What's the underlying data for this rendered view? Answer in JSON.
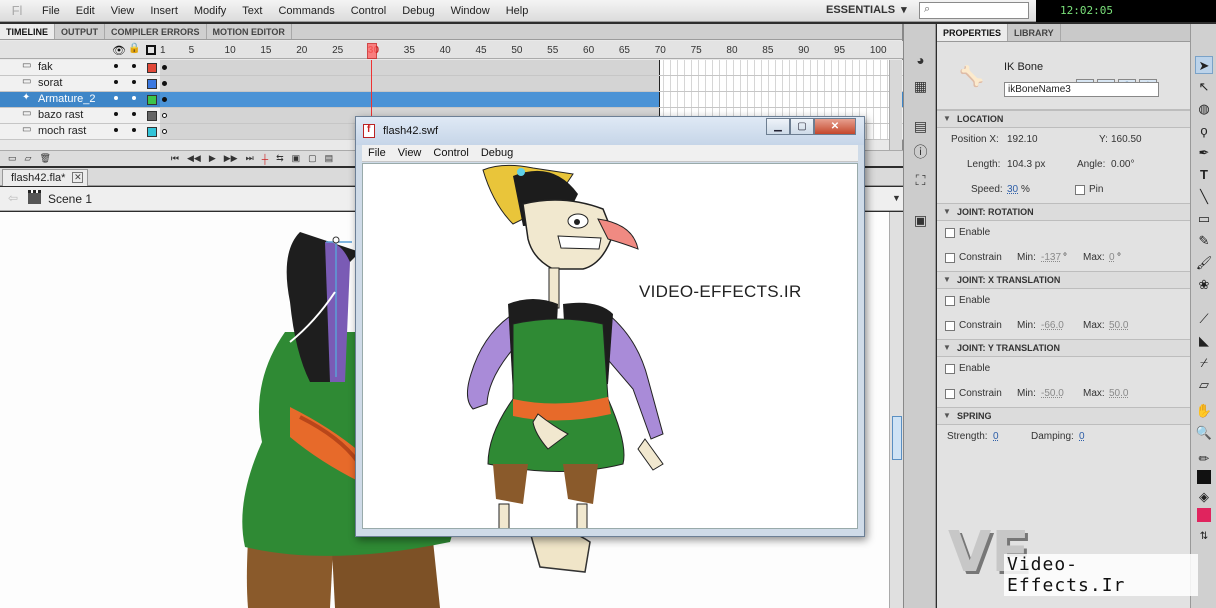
{
  "app": {
    "menu": [
      "File",
      "Edit",
      "View",
      "Insert",
      "Modify",
      "Text",
      "Commands",
      "Control",
      "Debug",
      "Window",
      "Help"
    ],
    "workspace": "ESSENTIALS",
    "search_placeholder": "",
    "clock": "12:02:05"
  },
  "timeline": {
    "tabs": [
      "TIMELINE",
      "OUTPUT",
      "COMPILER ERRORS",
      "MOTION EDITOR"
    ],
    "frame_numbers": [
      "1",
      "5",
      "10",
      "15",
      "20",
      "25",
      "30",
      "35",
      "40",
      "45",
      "50",
      "55",
      "60",
      "65",
      "70",
      "75",
      "80",
      "85",
      "90",
      "95",
      "100"
    ],
    "current_frame": "30",
    "layers": [
      {
        "name": "fak",
        "color": "#e34a3a",
        "selected": false,
        "filled": true
      },
      {
        "name": "sorat",
        "color": "#3a78e0",
        "selected": false,
        "filled": true
      },
      {
        "name": "Armature_2",
        "color": "#3cc44a",
        "selected": true,
        "filled": true
      },
      {
        "name": "bazo rast",
        "color": "#666666",
        "selected": false,
        "filled": false
      },
      {
        "name": "moch rast",
        "color": "#33c4d8",
        "selected": false,
        "filled": false
      }
    ]
  },
  "document": {
    "tab": "flash42.fla*",
    "scene": "Scene 1"
  },
  "swf_window": {
    "title": "flash42.swf",
    "menu": [
      "File",
      "View",
      "Control",
      "Debug"
    ],
    "watermark": "VIDEO-EFFECTS.IR"
  },
  "properties": {
    "tabs": [
      "PROPERTIES",
      "LIBRARY"
    ],
    "object_type": "IK Bone",
    "instance_name": "ikBoneName3",
    "location": {
      "section": "LOCATION",
      "pos_x_label": "Position X:",
      "pos_x": "192.10",
      "pos_y_label": "Y:",
      "pos_y": "160.50",
      "length_label": "Length:",
      "length": "104.3 px",
      "angle_label": "Angle:",
      "angle": "0.00°",
      "speed_label": "Speed:",
      "speed": "30",
      "speed_unit": "%",
      "pin_label": "Pin"
    },
    "joint_rotation": {
      "section": "JOINT: ROTATION",
      "enable": "Enable",
      "constrain": "Constrain",
      "min_label": "Min:",
      "min": "-137",
      "min_unit": "°",
      "max_label": "Max:",
      "max": "0",
      "max_unit": "°"
    },
    "joint_x": {
      "section": "JOINT: X TRANSLATION",
      "enable": "Enable",
      "constrain": "Constrain",
      "min_label": "Min:",
      "min": "-66.0",
      "max_label": "Max:",
      "max": "50.0"
    },
    "joint_y": {
      "section": "JOINT: Y TRANSLATION",
      "enable": "Enable",
      "constrain": "Constrain",
      "min_label": "Min:",
      "min": "-50.0",
      "max_label": "Max:",
      "max": "50.0"
    },
    "spring": {
      "section": "SPRING",
      "strength_label": "Strength:",
      "strength": "0",
      "damping_label": "Damping:",
      "damping": "0"
    }
  },
  "branding": {
    "mark": "VE",
    "text": "Video-Effects.Ir"
  },
  "icons": {
    "tools": [
      "selection-tool-icon",
      "subselection-tool-icon",
      "3d-rotation-tool-icon",
      "lasso-tool-icon",
      "pen-tool-icon",
      "text-tool-icon",
      "line-tool-icon",
      "rectangle-tool-icon",
      "pencil-tool-icon",
      "brush-tool-icon",
      "deco-tool-icon",
      "bone-tool-icon",
      "paint-bucket-tool-icon",
      "eyedropper-tool-icon",
      "eraser-tool-icon",
      "hand-tool-icon",
      "zoom-tool-icon",
      "stroke-color-icon",
      "fill-color-icon"
    ]
  }
}
